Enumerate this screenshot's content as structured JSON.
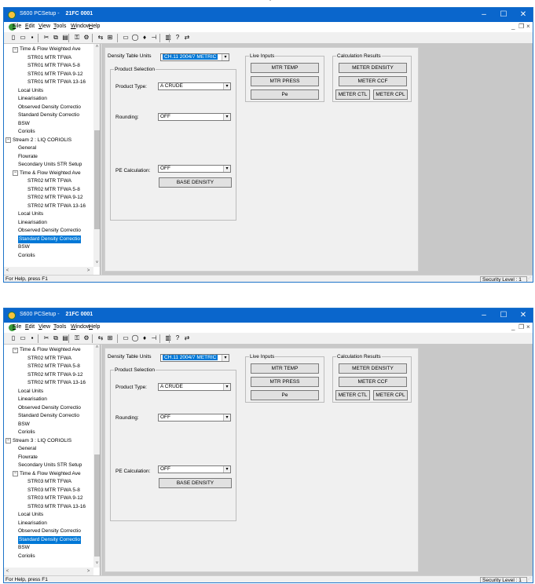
{
  "top_mark": "''",
  "windows": [
    {
      "title": "S600 PCSetup",
      "title_sep": " - ",
      "device": "21FC 0001",
      "window_controls": {
        "minimize": "–",
        "maximize": "☐",
        "close": "✕"
      },
      "menu": [
        "File",
        "Edit",
        "View",
        "Tools",
        "Window",
        "Help"
      ],
      "mdi_controls": {
        "minimize": "_",
        "restore": "❐",
        "close": "×"
      },
      "toolbar_icons": [
        "new-icon",
        "open-icon",
        "save-icon",
        "cut-icon",
        "copy-icon",
        "paste-icon",
        "key-icon",
        "settings-icon",
        "connect-icon",
        "grid-icon",
        "rect-icon",
        "stop-icon",
        "tree-icon",
        "chart-icon",
        "print-icon",
        "help-icon",
        "arrow-icon"
      ],
      "tree_items": [
        {
          "label": "Time & Flow Weighted Ave",
          "level": 1,
          "expander": "minus"
        },
        {
          "label": "STR01 MTR TFWA",
          "level": 2
        },
        {
          "label": "STR01 MTR TFWA 5-8",
          "level": 2
        },
        {
          "label": "STR01 MTR TFWA 9-12",
          "level": 2
        },
        {
          "label": "STR01 MTR TFWA 13-16",
          "level": 2
        },
        {
          "label": "Local Units",
          "level": 1
        },
        {
          "label": "Linearisation",
          "level": 1
        },
        {
          "label": "Observed Density Correctio",
          "level": 1
        },
        {
          "label": "Standard Density Correctio",
          "level": 1
        },
        {
          "label": "BSW",
          "level": 1
        },
        {
          "label": "Coriolis",
          "level": 1
        },
        {
          "label": "Stream 2 : LIQ CORIOLIS",
          "level": 0,
          "expander": "minus"
        },
        {
          "label": "General",
          "level": 1
        },
        {
          "label": "Flowrate",
          "level": 1
        },
        {
          "label": "Secondary Units STR Setup",
          "level": 1
        },
        {
          "label": "Time & Flow Weighted Ave",
          "level": 1,
          "expander": "minus"
        },
        {
          "label": "STR02 MTR TFWA",
          "level": 2
        },
        {
          "label": "STR02 MTR TFWA 5-8",
          "level": 2
        },
        {
          "label": "STR02 MTR TFWA 9-12",
          "level": 2
        },
        {
          "label": "STR02 MTR TFWA 13-16",
          "level": 2
        },
        {
          "label": "Local Units",
          "level": 1
        },
        {
          "label": "Linearisation",
          "level": 1
        },
        {
          "label": "Observed Density Correctio",
          "level": 1
        },
        {
          "label": "Standard Density Correctio",
          "level": 1,
          "selected": true
        },
        {
          "label": "BSW",
          "level": 1
        },
        {
          "label": "Coriolis",
          "level": 1
        }
      ],
      "scroll_arrows": {
        "up": "˄",
        "down": "˅",
        "left": "<",
        "right": ">"
      },
      "form": {
        "density_units_label": "Density Table Units",
        "density_units_value": "CH.11 2004/7 METRIC",
        "product_selection_title": "Product Selection",
        "product_type_label": "Product Type:",
        "product_type_value": "A CRUDE",
        "rounding_label": "Rounding:",
        "rounding_value": "OFF",
        "pe_calc_label": "PE Calculation:",
        "pe_calc_value": "OFF",
        "base_density_button": "BASE DENSITY",
        "live_inputs_title": "Live Inputs",
        "live_inputs_buttons": [
          "MTR TEMP",
          "MTR PRESS",
          "Pe"
        ],
        "calc_results_title": "Calculation Results",
        "meter_density_button": "METER DENSITY",
        "meter_ccf_button": "METER CCF",
        "meter_ctl_button": "METER CTL",
        "meter_cpl_button": "METER CPL"
      },
      "status_text": "For Help, press F1",
      "security_level": "Security Level : 1"
    },
    {
      "title": "S600 PCSetup",
      "title_sep": " - ",
      "device": "21FC 0001",
      "window_controls": {
        "minimize": "–",
        "maximize": "☐",
        "close": "✕"
      },
      "menu": [
        "File",
        "Edit",
        "View",
        "Tools",
        "Window",
        "Help"
      ],
      "mdi_controls": {
        "minimize": "_",
        "restore": "❐",
        "close": "×"
      },
      "toolbar_icons": [
        "new-icon",
        "open-icon",
        "save-icon",
        "cut-icon",
        "copy-icon",
        "paste-icon",
        "key-icon",
        "settings-icon",
        "connect-icon",
        "grid-icon",
        "rect-icon",
        "stop-icon",
        "tree-icon",
        "chart-icon",
        "print-icon",
        "help-icon",
        "arrow-icon"
      ],
      "tree_items": [
        {
          "label": "Time & Flow Weighted Ave",
          "level": 1,
          "expander": "minus"
        },
        {
          "label": "STR02 MTR TFWA",
          "level": 2
        },
        {
          "label": "STR02 MTR TFWA 5-8",
          "level": 2
        },
        {
          "label": "STR02 MTR TFWA 9-12",
          "level": 2
        },
        {
          "label": "STR02 MTR TFWA 13-16",
          "level": 2
        },
        {
          "label": "Local Units",
          "level": 1
        },
        {
          "label": "Linearisation",
          "level": 1
        },
        {
          "label": "Observed Density Correctio",
          "level": 1
        },
        {
          "label": "Standard Density Correctio",
          "level": 1
        },
        {
          "label": "BSW",
          "level": 1
        },
        {
          "label": "Coriolis",
          "level": 1
        },
        {
          "label": "Stream 3 : LIQ CORIOLIS",
          "level": 0,
          "expander": "minus"
        },
        {
          "label": "General",
          "level": 1
        },
        {
          "label": "Flowrate",
          "level": 1
        },
        {
          "label": "Secondary Units STR Setup",
          "level": 1
        },
        {
          "label": "Time & Flow Weighted Ave",
          "level": 1,
          "expander": "minus"
        },
        {
          "label": "STR03 MTR TFWA",
          "level": 2
        },
        {
          "label": "STR03 MTR TFWA 5-8",
          "level": 2
        },
        {
          "label": "STR03 MTR TFWA 9-12",
          "level": 2
        },
        {
          "label": "STR03 MTR TFWA 13-16",
          "level": 2
        },
        {
          "label": "Local Units",
          "level": 1
        },
        {
          "label": "Linearisation",
          "level": 1
        },
        {
          "label": "Observed Density Correctio",
          "level": 1
        },
        {
          "label": "Standard Density Correctio",
          "level": 1,
          "selected": true
        },
        {
          "label": "BSW",
          "level": 1
        },
        {
          "label": "Coriolis",
          "level": 1
        }
      ],
      "scroll_arrows": {
        "up": "˄",
        "down": "˅",
        "left": "<",
        "right": ">"
      },
      "form": {
        "density_units_label": "Density Table Units",
        "density_units_value": "CH.11 2004/7 METRIC",
        "product_selection_title": "Product Selection",
        "product_type_label": "Product Type:",
        "product_type_value": "A CRUDE",
        "rounding_label": "Rounding:",
        "rounding_value": "OFF",
        "pe_calc_label": "PE Calculation:",
        "pe_calc_value": "OFF",
        "base_density_button": "BASE DENSITY",
        "live_inputs_title": "Live Inputs",
        "live_inputs_buttons": [
          "MTR TEMP",
          "MTR PRESS",
          "Pe"
        ],
        "calc_results_title": "Calculation Results",
        "meter_density_button": "METER DENSITY",
        "meter_ccf_button": "METER CCF",
        "meter_ctl_button": "METER CTL",
        "meter_cpl_button": "METER CPL"
      },
      "status_text": "For Help, press F1",
      "security_level": "Security Level : 1"
    }
  ]
}
